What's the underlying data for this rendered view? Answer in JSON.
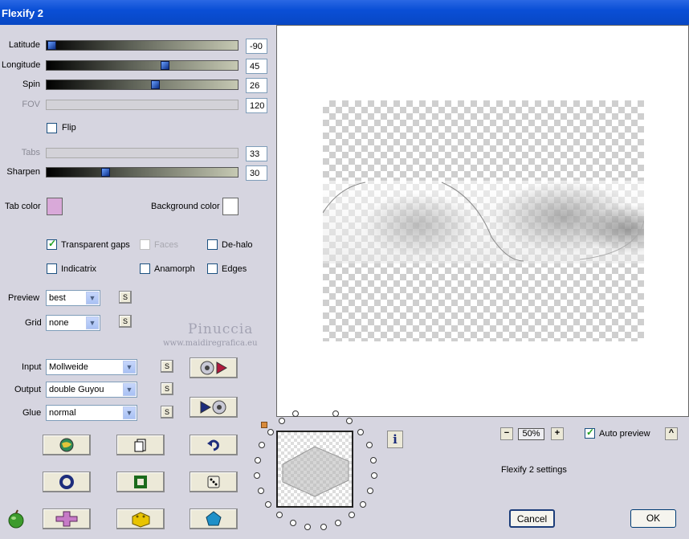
{
  "window": {
    "title": "Flexify 2"
  },
  "sliders": {
    "latitude": {
      "label": "Latitude",
      "value": "-90"
    },
    "longitude": {
      "label": "Longitude",
      "value": "45"
    },
    "spin": {
      "label": "Spin",
      "value": "26"
    },
    "fov": {
      "label": "FOV",
      "value": "120"
    },
    "tabs": {
      "label": "Tabs",
      "value": "33"
    },
    "sharpen": {
      "label": "Sharpen",
      "value": "30"
    }
  },
  "flip": {
    "label": "Flip",
    "checked": false
  },
  "colors": {
    "tab_color_label": "Tab color",
    "tab_color": "#d9a9d9",
    "bg_color_label": "Background color",
    "bg_color": "#ffffff"
  },
  "options": {
    "transparent_gaps": {
      "label": "Transparent gaps",
      "checked": true
    },
    "faces": {
      "label": "Faces",
      "checked": false
    },
    "dehalo": {
      "label": "De-halo",
      "checked": false
    },
    "indicatrix": {
      "label": "Indicatrix",
      "checked": false
    },
    "anamorph": {
      "label": "Anamorph",
      "checked": false
    },
    "edges": {
      "label": "Edges",
      "checked": false
    }
  },
  "preview_select": {
    "label": "Preview",
    "value": "best"
  },
  "grid_select": {
    "label": "Grid",
    "value": "none"
  },
  "input_select": {
    "label": "Input",
    "value": "Mollweide"
  },
  "output_select": {
    "label": "Output",
    "value": "double Guyou"
  },
  "glue_select": {
    "label": "Glue",
    "value": "normal"
  },
  "s_button_label": "S",
  "watermark": {
    "name": "Pinuccia",
    "url": "www.maidiregrafica.eu"
  },
  "zoom": {
    "minus": "−",
    "value": "50%",
    "plus": "+"
  },
  "auto_preview": {
    "label": "Auto preview",
    "checked": true
  },
  "settings_label": "Flexify 2 settings",
  "info_label": "i",
  "up_label": "^",
  "buttons": {
    "cancel": "Cancel",
    "ok": "OK"
  }
}
